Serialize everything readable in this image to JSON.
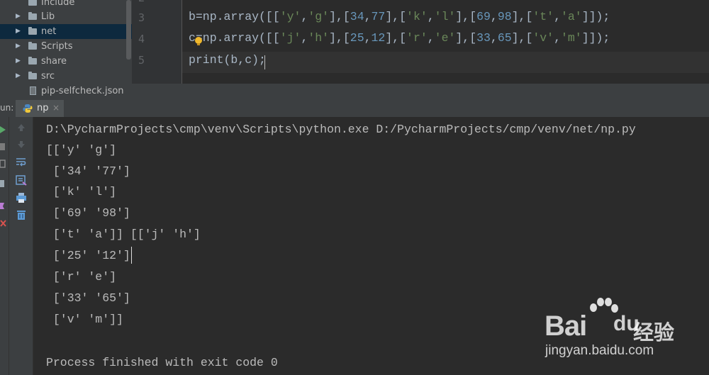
{
  "project_tree": {
    "items": [
      {
        "label": "Include",
        "kind": "folder"
      },
      {
        "label": "Lib",
        "kind": "folder"
      },
      {
        "label": "net",
        "kind": "folder",
        "selected": true
      },
      {
        "label": "Scripts",
        "kind": "folder"
      },
      {
        "label": "share",
        "kind": "folder"
      },
      {
        "label": "src",
        "kind": "folder"
      },
      {
        "label": "pip-selfcheck.json",
        "kind": "file"
      }
    ]
  },
  "editor": {
    "line_numbers": [
      "3",
      "4",
      "5"
    ],
    "code": {
      "line3": {
        "var": "b",
        "assign": "=np.array([[",
        "s1": "'y'",
        "c1": ",",
        "s2": "'g'",
        "c2": "],[",
        "n1": "34",
        "c3": ",",
        "n2": "77",
        "c4": "],[",
        "s3": "'k'",
        "c5": ",",
        "s4": "'l'",
        "c6": "],[",
        "n3": "69",
        "c7": ",",
        "n4": "98",
        "c8": "],[",
        "s5": "'t'",
        "c9": ",",
        "s6": "'a'",
        "end": "]]);"
      },
      "line4": {
        "var": "c=np.array([[",
        "s1": "'j'",
        "c1": ",",
        "s2": "'h'",
        "c2": "],[",
        "n1": "25",
        "c3": ",",
        "n2": "12",
        "c4": "],[",
        "s3": "'r'",
        "c5": ",",
        "s4": "'e'",
        "c6": "],[",
        "n3": "33",
        "c7": ",",
        "n4": "65",
        "c8": "],[",
        "s5": "'v'",
        "c9": ",",
        "s6": "'m'",
        "end": "]]);"
      },
      "line5": "print(b,c);"
    }
  },
  "run_window": {
    "label": "un:",
    "tab_label": "np",
    "tab_close": "×"
  },
  "console": {
    "lines": [
      "D:\\PycharmProjects\\cmp\\venv\\Scripts\\python.exe D:/PycharmProjects/cmp/venv/net/np.py",
      "[['y' 'g']",
      " ['34' '77']",
      " ['k' 'l']",
      " ['69' '98']",
      " ['t' 'a']] [['j' 'h']",
      " ['25' '12']",
      " ['r' 'e']",
      " ['33' '65']",
      " ['v' 'm']]",
      "",
      "Process finished with exit code 0"
    ]
  },
  "watermark": {
    "bai": "Bai",
    "du": "du",
    "jingyan": "经验",
    "url": "jingyan.baidu.com"
  },
  "icons": {
    "run_toolbar": [
      "rerun-icon",
      "stop-icon",
      "scroll-up-icon",
      "scroll-down-icon",
      "soft-wrap-icon",
      "scroll-to-end-icon",
      "print-icon",
      "trash-icon"
    ]
  },
  "colors": {
    "editor_bg": "#2b2b2b",
    "panel_bg": "#3c3f41",
    "number": "#6897bb",
    "string": "#6a8759",
    "text": "#a9b7c6"
  }
}
